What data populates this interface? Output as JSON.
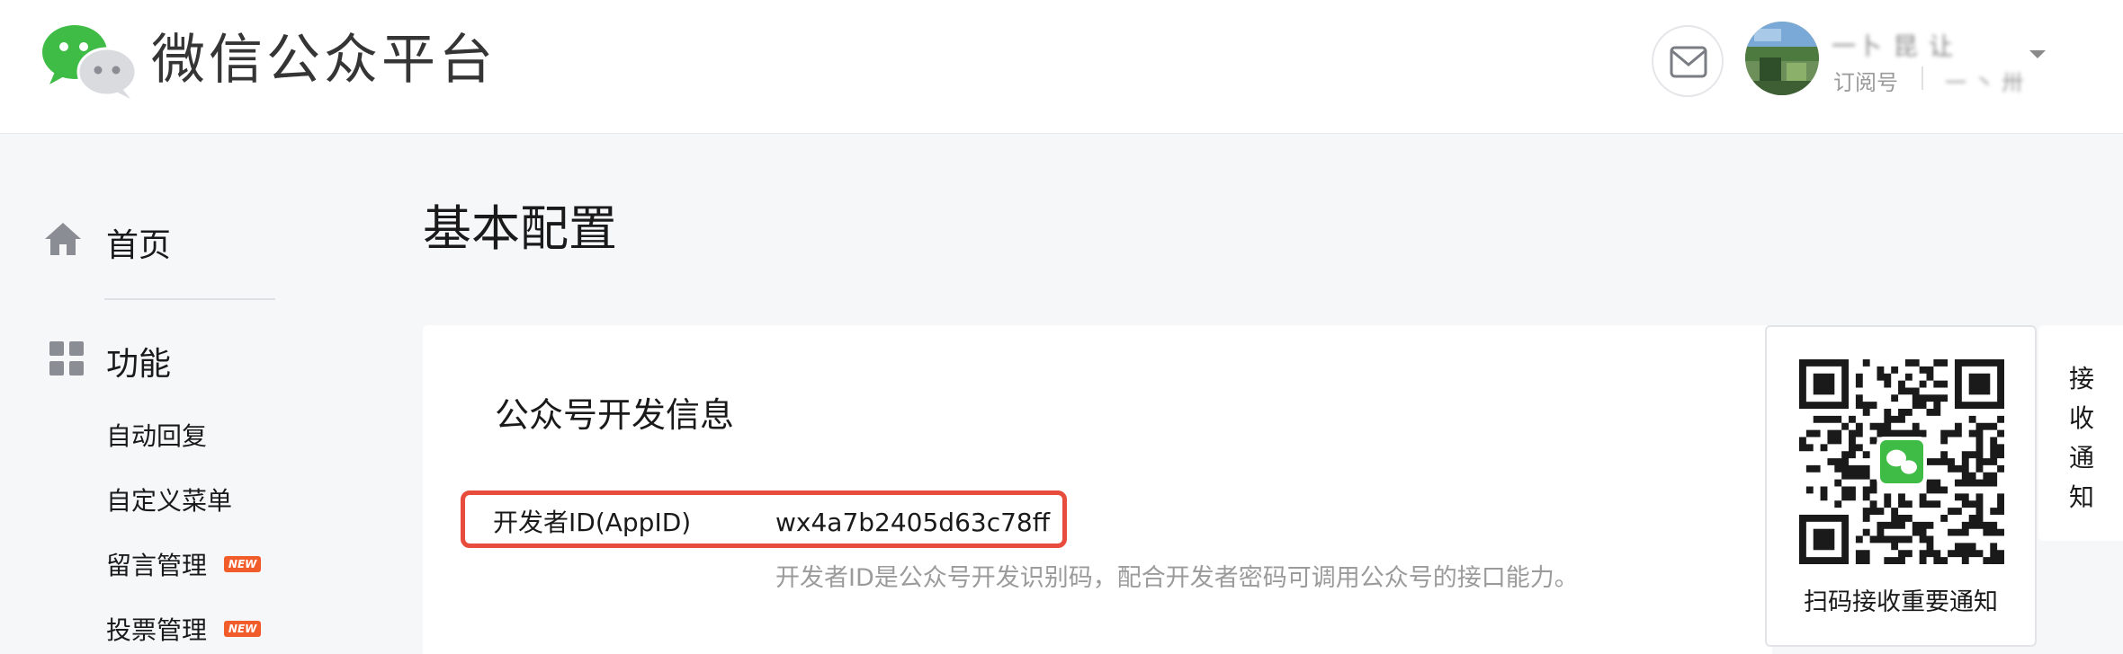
{
  "header": {
    "brand": "微信公众平台",
    "account": {
      "name": "一卜 昆 让",
      "type": "订阅号",
      "id": "一 丶 卅"
    }
  },
  "sidebar": {
    "home_label": "首页",
    "section_label": "功能",
    "items": [
      {
        "label": "自动回复",
        "badge": ""
      },
      {
        "label": "自定义菜单",
        "badge": ""
      },
      {
        "label": "留言管理",
        "badge": "NEW"
      },
      {
        "label": "投票管理",
        "badge": "NEW"
      }
    ]
  },
  "main": {
    "page_title": "基本配置",
    "section_title": "公众号开发信息",
    "appid_label": "开发者ID(AppID)",
    "appid_value": "wx4a7b2405d63c78ff",
    "appid_hint": "开发者ID是公众号开发识别码，配合开发者密码可调用公众号的接口能力。"
  },
  "qr_panel": {
    "caption": "扫码接收重要通知"
  },
  "notify_tab": {
    "label": "接收通知"
  },
  "colors": {
    "highlight_border": "#e84c3d",
    "badge_new": "#f25b2a",
    "wechat_green": "#3fbc46",
    "background": "#f6f7f9"
  },
  "icons": {
    "logo": "wechat-logo-icon",
    "mail": "mail-icon",
    "home": "home-icon",
    "features": "grid-icon",
    "dropdown": "caret-down-icon"
  }
}
